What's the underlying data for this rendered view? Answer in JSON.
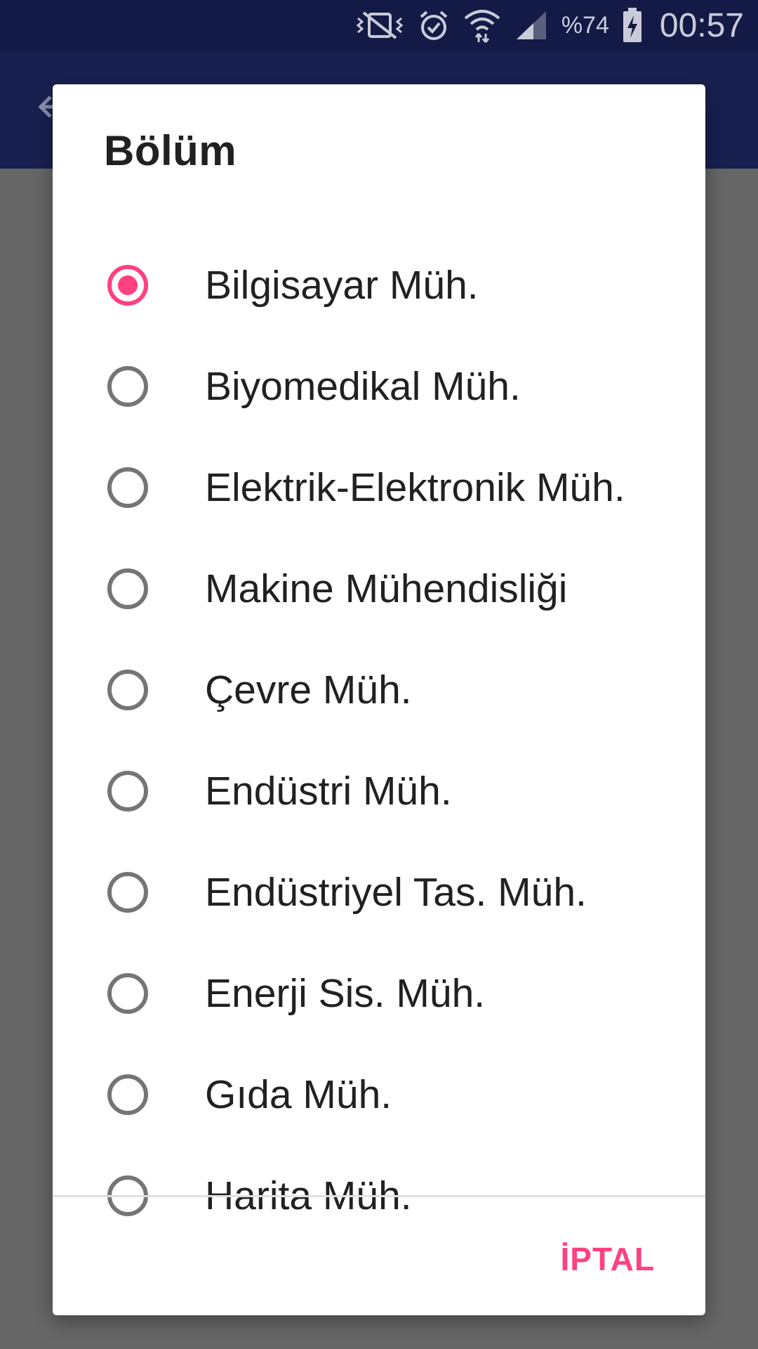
{
  "status_bar": {
    "battery_percent": "%74",
    "time": "00:57",
    "icons": [
      "vibrate-off-icon",
      "alarm-icon",
      "wifi-icon",
      "signal-icon",
      "battery-charging-icon"
    ]
  },
  "dialog": {
    "title": "Bölüm",
    "options": [
      {
        "label": "Bilgisayar Müh.",
        "checked": true
      },
      {
        "label": "Biyomedikal Müh.",
        "checked": false
      },
      {
        "label": "Elektrik-Elektronik Müh.",
        "checked": false
      },
      {
        "label": "Makine Mühendisliği",
        "checked": false
      },
      {
        "label": "Çevre Müh.",
        "checked": false
      },
      {
        "label": "Endüstri Müh.",
        "checked": false
      },
      {
        "label": "Endüstriyel Tas. Müh.",
        "checked": false
      },
      {
        "label": "Enerji Sis. Müh.",
        "checked": false
      },
      {
        "label": "Gıda Müh.",
        "checked": false
      },
      {
        "label": "Harita Müh.",
        "checked": false
      }
    ],
    "cancel_label": "İPTAL"
  },
  "colors": {
    "accent": "#ff4081",
    "status_bar": "#141a46",
    "app_bar": "#18204f",
    "scrim": "#666666"
  }
}
